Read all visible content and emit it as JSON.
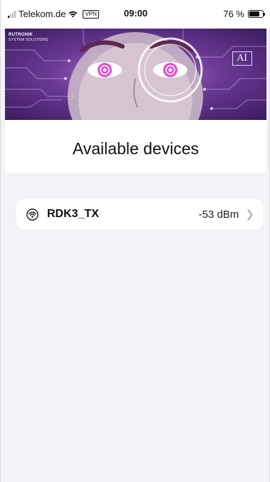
{
  "status_bar": {
    "carrier": "Telekom.de",
    "vpn_label": "VPN",
    "time": "09:00",
    "battery_percent": "76 %",
    "battery_level": 0.76
  },
  "banner": {
    "brand_line1": "RUTRONIK",
    "brand_line2": "SYSTEM SOLUTIONS",
    "ai_label": "AI"
  },
  "page": {
    "title": "Available devices"
  },
  "devices": [
    {
      "name": "RDK3_TX",
      "signal": "-53 dBm"
    }
  ]
}
